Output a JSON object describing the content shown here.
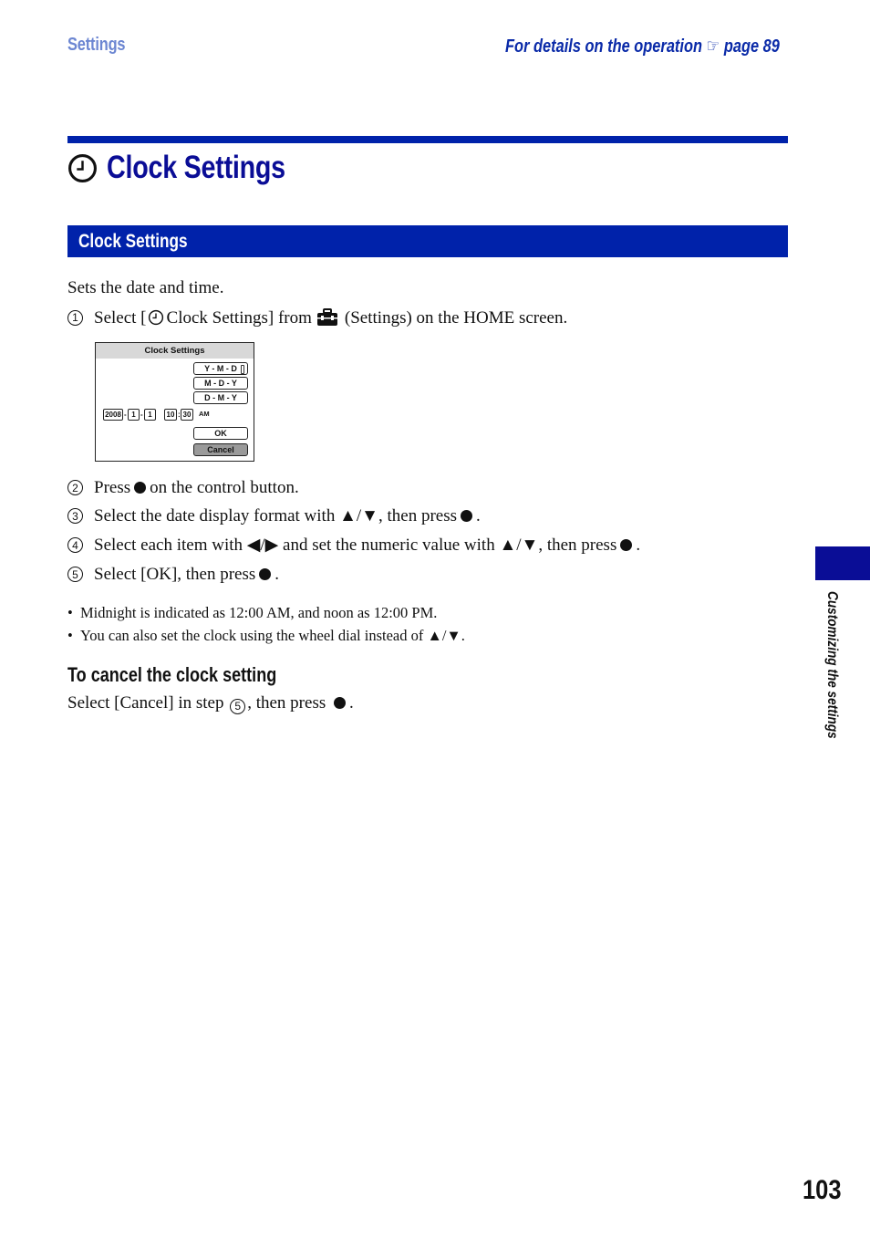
{
  "header": {
    "section": "Settings",
    "details_text": "For details on the operation",
    "details_icon": "pointing-hand-icon",
    "details_page": "page 89"
  },
  "title": {
    "icon": "clock-icon",
    "text": "Clock Settings"
  },
  "section_bar": {
    "label": "Clock Settings"
  },
  "intro": "Sets the date and time.",
  "steps": [
    {
      "num": "1",
      "parts": [
        "Select [",
        "Clock Settings] from",
        "(Settings) on the HOME screen."
      ]
    },
    {
      "num": "2",
      "parts": [
        "Press",
        "on the control button."
      ]
    },
    {
      "num": "3",
      "parts": [
        "Select the date display format with ▲/▼, then press",
        "."
      ]
    },
    {
      "num": "4",
      "parts": [
        "Select each item with ◀/▶ and set the numeric value with ▲/▼, then press",
        "."
      ]
    },
    {
      "num": "5",
      "parts": [
        "Select [OK], then press",
        "."
      ]
    }
  ],
  "camera_screen": {
    "title": "Clock Settings",
    "formats": [
      "Y - M - D",
      "M - D - Y",
      "D - M - Y"
    ],
    "selected_format": "Y - M - D",
    "year": "2008",
    "month": "1",
    "day": "1",
    "hour": "10",
    "minute": "30",
    "date_sep": "-",
    "time_sep": ":",
    "ampm": "AM",
    "ok_label": "OK",
    "cancel_label": "Cancel"
  },
  "notes": [
    "Midnight is indicated as 12:00 AM, and noon as 12:00 PM.",
    "You can also set the clock using the wheel dial instead of ▲/▼."
  ],
  "cancel_section": {
    "heading": "To cancel the clock setting",
    "text_before": "Select [Cancel] in step",
    "step_ref": "5",
    "text_after": ", then press",
    "end": "."
  },
  "side_tab": {
    "label": "Customizing the settings",
    "color": "#0a0d96"
  },
  "page_number": "103",
  "colors": {
    "accent_blue": "#0022aa",
    "title_blue": "#0a0d96",
    "header_light_blue": "#6c86d2"
  }
}
